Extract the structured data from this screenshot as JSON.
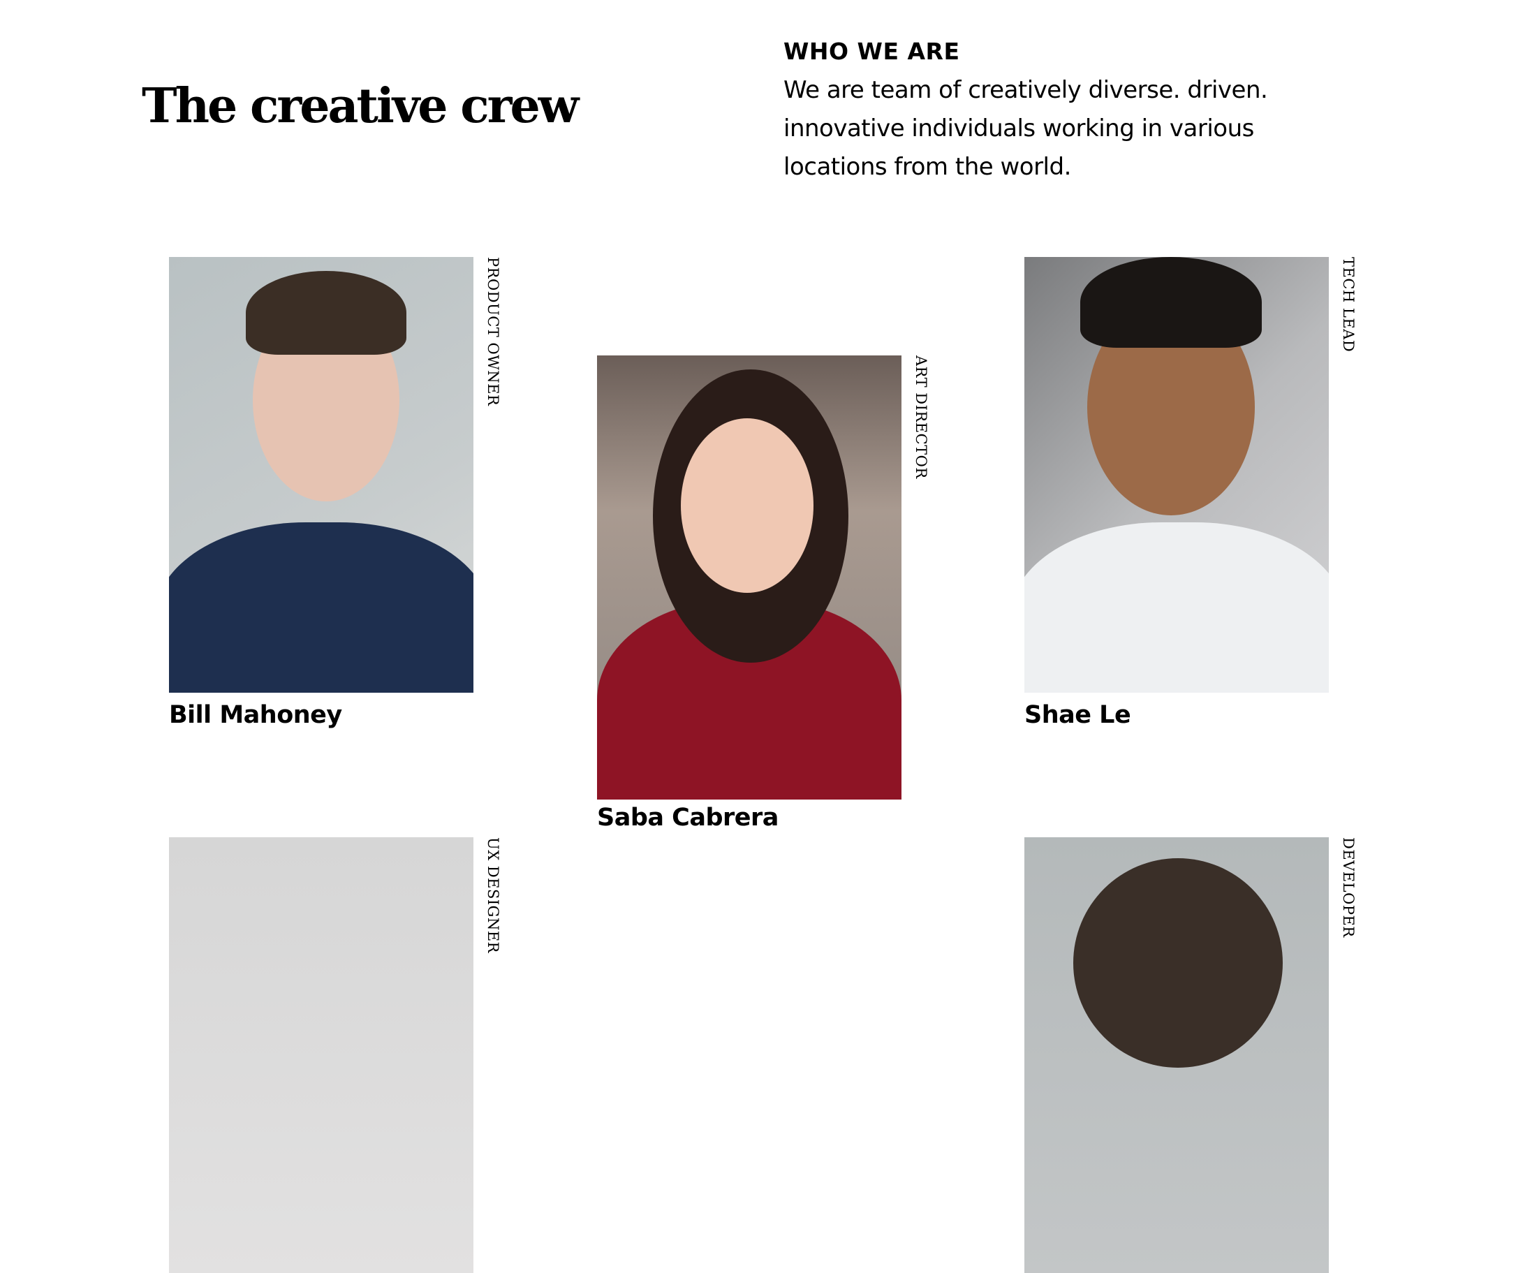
{
  "header": {
    "title": "The creative crew",
    "eyebrow": "WHO WE ARE",
    "description": "We are team of creatively diverse. driven. innovative individuals working in various locations from the world."
  },
  "team": [
    {
      "name": "Bill Mahoney",
      "role": "PRODUCT OWNER"
    },
    {
      "name": "Saba Cabrera",
      "role": "ART DIRECTOR"
    },
    {
      "name": "Shae Le",
      "role": "TECH LEAD"
    },
    {
      "name": "",
      "role": "UX DESIGNER"
    },
    {
      "name": "",
      "role": "DEVELOPER"
    }
  ]
}
